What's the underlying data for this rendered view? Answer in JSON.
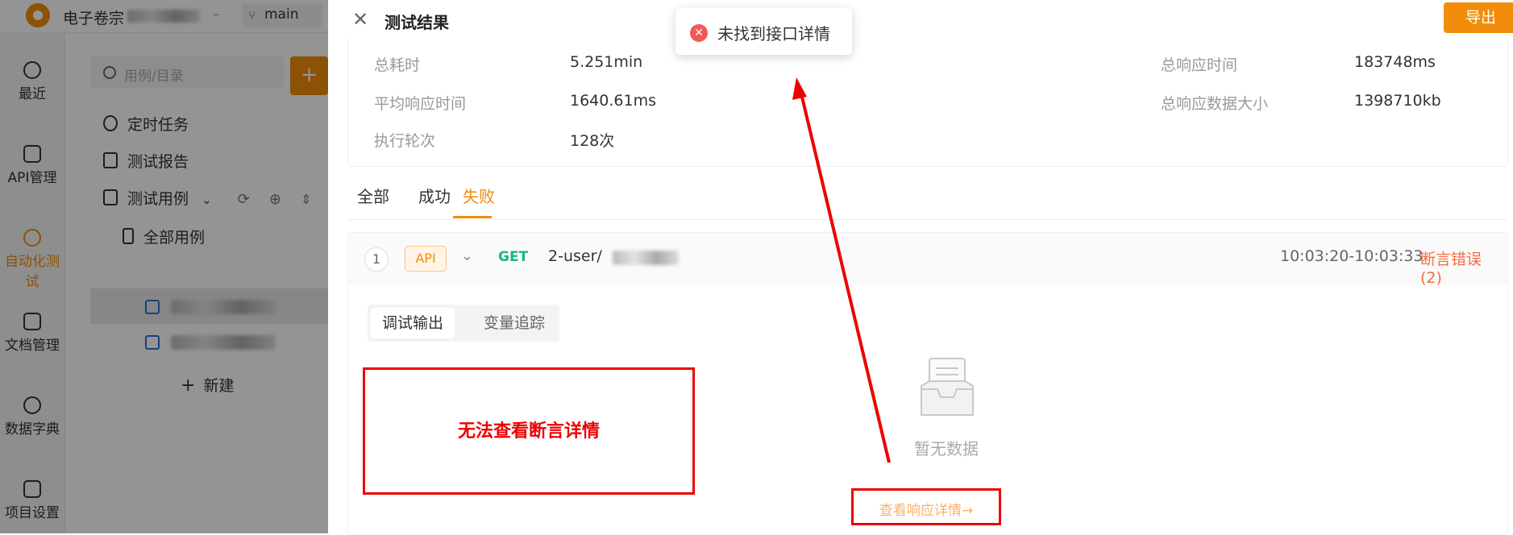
{
  "app": {
    "project_name": "电子卷宗",
    "branch": "main",
    "search_placeholder": "用例/目录",
    "add_label": "+"
  },
  "leftnav": [
    {
      "label": "最近",
      "icon": "clock-icon"
    },
    {
      "label": "API管理",
      "icon": "api-icon"
    },
    {
      "label": "自动化测试",
      "icon": "automation-icon",
      "active": true
    },
    {
      "label": "文档管理",
      "icon": "document-icon"
    },
    {
      "label": "数据字典",
      "icon": "dictionary-icon"
    },
    {
      "label": "项目设置",
      "icon": "settings-icon"
    }
  ],
  "tree": {
    "items": [
      "定时任务",
      "测试报告",
      "测试用例"
    ],
    "all_cases": "全部用例",
    "new_label": "新建"
  },
  "drawer": {
    "title": "测试结果",
    "export_label": "导出"
  },
  "stats": {
    "total_time_label": "总耗时",
    "total_time": "5.251min",
    "total_resp_label": "总响应时间",
    "total_resp": "183748ms",
    "avg_resp_label": "平均响应时间",
    "avg_resp": "1640.61ms",
    "total_size_label": "总响应数据大小",
    "total_size": "1398710kb",
    "rounds_label": "执行轮次",
    "rounds": "128次"
  },
  "tabs": [
    "全部",
    "成功",
    "失败"
  ],
  "active_tab": "失败",
  "case": {
    "index": "1",
    "tag": "API",
    "method": "GET",
    "name": "2-user/",
    "time_range": "10:03:20-10:03:33",
    "status": "断言错误 (2)",
    "subtabs": [
      "调试输出",
      "变量追踪"
    ],
    "empty_text": "暂无数据",
    "link_text": "查看响应详情→"
  },
  "annotation": {
    "text": "无法查看断言详情"
  },
  "toast": {
    "text": "未找到接口详情"
  },
  "colors": {
    "accent": "#f18d0a",
    "error": "#e00000",
    "get_method": "#18b77b"
  }
}
